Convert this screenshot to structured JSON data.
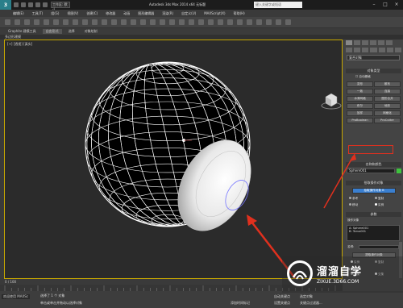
{
  "app": {
    "title": "Autodesk 3ds Max 2014 x64   无标题",
    "workspace": "工作区: 默认",
    "search_placeholder": "键入关键字或短语"
  },
  "menus": [
    "编辑(E)",
    "工具(T)",
    "组(G)",
    "视图(V)",
    "创建(C)",
    "修改器",
    "动画",
    "图形编辑器",
    "渲染(R)",
    "自定义(U)",
    "MAXScript(X)",
    "帮助(H)"
  ],
  "ribbon": {
    "tabs": [
      "Graphite 建模工具",
      "自由形式",
      "选择",
      "对象绘制"
    ],
    "active_tab": 1,
    "subbar": "多边形建模"
  },
  "viewport": {
    "label": "[+] [透视] [真实]"
  },
  "command_panel": {
    "category_dropdown": "复合对象",
    "object_type_header": "对象类型",
    "autogrid": "自动栅格",
    "buttons": [
      [
        "变形",
        "散布"
      ],
      [
        "一致",
        "连接"
      ],
      [
        "水滴网格",
        "图形合并"
      ],
      [
        "布尔",
        "地形"
      ],
      [
        "放样",
        "网格化"
      ],
      [
        "ProBoolean",
        "ProCutter"
      ]
    ],
    "name_color_header": "名称和颜色",
    "object_name": "Sphere001",
    "pick_operand_header": "拾取操作对象",
    "pick_button": "拾取操作对象 B",
    "op_modes": [
      "参考",
      "复制",
      "移动",
      "实例"
    ],
    "params_header": "参数",
    "operands_label": "操作对象",
    "operands": [
      "A: Sphere001",
      "B: Torus001"
    ],
    "name_label": "名称:",
    "extract_button": "提取操作对象",
    "extract_modes": [
      "实例",
      "复制"
    ],
    "operation_label": "操作",
    "operation_options": [
      "并集",
      "交集",
      "差集(A-B)"
    ]
  },
  "timeline": {
    "frame": "0 / 100"
  },
  "status": {
    "line1": "选择了 1 个 对象",
    "line2": "单击或单击并拖动以选择对象",
    "maxscript_label": "欢迎使用 MAXSc",
    "autokey": "自动关键点",
    "selected": "选定对象",
    "setkey": "设置关键点",
    "keyfilter": "关键点过滤器...",
    "add_time_tag": "添加时间标记"
  },
  "watermark": {
    "title": "溜溜自学",
    "subtitle": "ZIXUE.3D66.COM"
  },
  "colors": {
    "viewport_bg": "#2b2b2b",
    "active_border": "#c8a800",
    "selected_button": "#3a7fd0",
    "annotation_red": "#e0301e",
    "object_color": "#3ec33e"
  }
}
